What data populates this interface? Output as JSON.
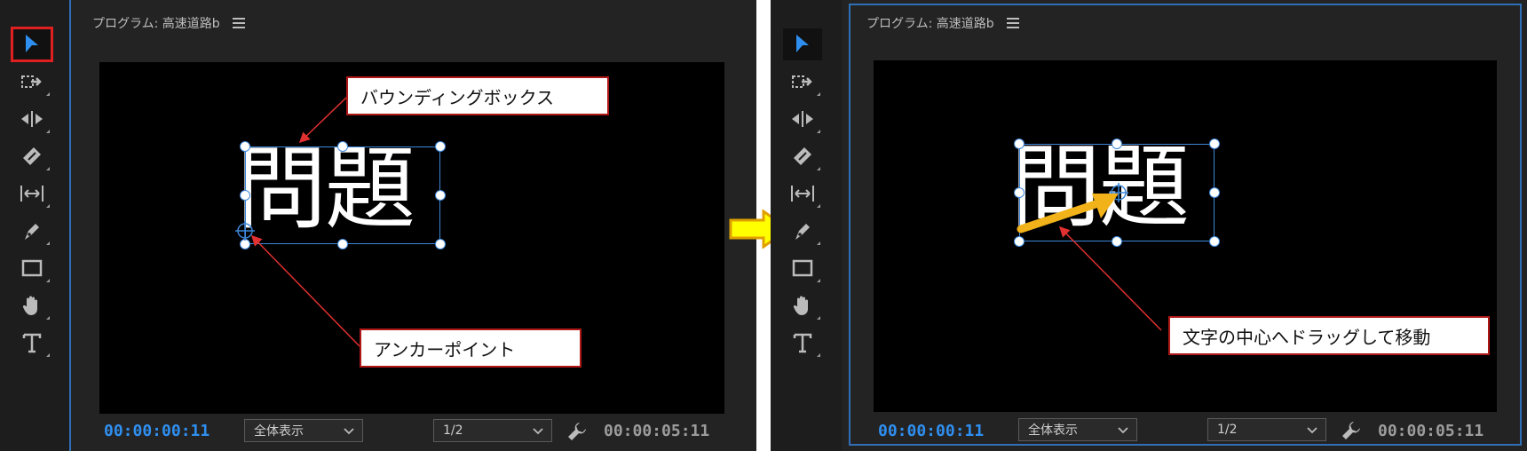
{
  "program_label": "プログラム: 高速道路b",
  "timecode_current": "00:00:00:11",
  "timecode_duration": "00:00:05:11",
  "zoom_select": "全体表示",
  "resolution_select": "1/2",
  "text_content": "問題",
  "callouts": {
    "bounding_box": "バウンディングボックス",
    "anchor_point": "アンカーポイント",
    "drag_instruction": "文字の中心へドラッグして移動"
  },
  "colors": {
    "accent_blue": "#2f8ff0",
    "selection_blue": "#3d87d9",
    "highlight_red": "#e02020",
    "arrow_yellow": "#ffff00",
    "drag_arrow": "#f2b21a"
  },
  "tools": [
    "selection-tool",
    "track-select-tool",
    "ripple-edit-tool",
    "razor-tool",
    "slip-tool",
    "pen-tool",
    "rectangle-tool",
    "hand-tool",
    "type-tool"
  ]
}
